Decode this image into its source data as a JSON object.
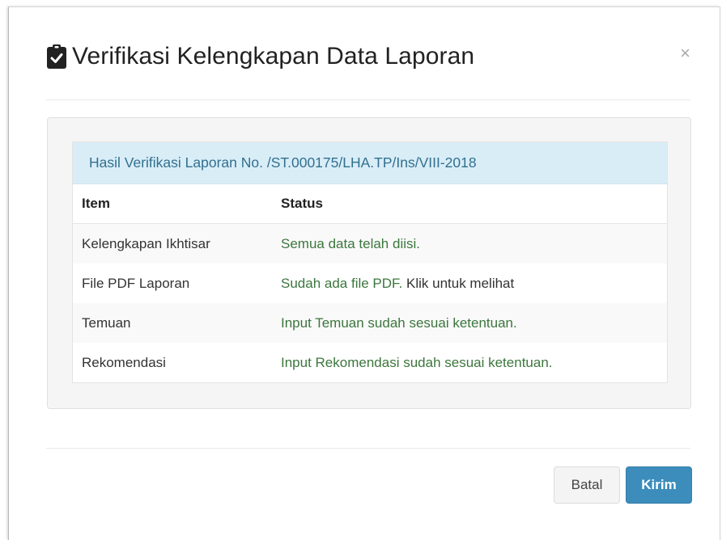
{
  "modal": {
    "title": "Verifikasi Kelengkapan Data Laporan",
    "title_icon": "clipboard-check-icon",
    "close_label": "×"
  },
  "panel": {
    "heading": "Hasil Verifikasi Laporan No. /ST.000175/LHA.TP/Ins/VIII-2018"
  },
  "table": {
    "headers": {
      "item": "Item",
      "status": "Status"
    },
    "rows": [
      {
        "item": "Kelengkapan Ikhtisar",
        "status": "Semua data telah diisi."
      },
      {
        "item": "File PDF Laporan",
        "status": "Sudah ada file PDF.",
        "link": "Klik untuk melihat"
      },
      {
        "item": "Temuan",
        "status": "Input Temuan sudah sesuai ketentuan."
      },
      {
        "item": "Rekomendasi",
        "status": "Input Rekomendasi sudah sesuai ketentuan."
      }
    ]
  },
  "footer": {
    "cancel_label": "Batal",
    "submit_label": "Kirim"
  },
  "colors": {
    "success_text": "#3c763d",
    "info_bg": "#d9edf7",
    "info_text": "#31708f",
    "primary": "#3c8dbc"
  }
}
